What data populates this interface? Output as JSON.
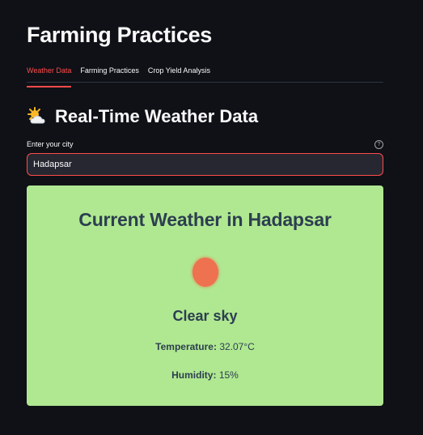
{
  "app": {
    "title": "Farming Practices"
  },
  "tabs": [
    {
      "label": "Weather Data",
      "active": true
    },
    {
      "label": "Farming Practices",
      "active": false
    },
    {
      "label": "Crop Yield Analysis",
      "active": false
    }
  ],
  "section": {
    "icon": "sun-behind-cloud-icon",
    "title": "Real-Time Weather Data"
  },
  "city_input": {
    "label": "Enter your city",
    "value": "Hadapsar",
    "help_icon": "question-circle-icon"
  },
  "weather": {
    "title": "Current Weather in Hadapsar",
    "icon": "sun-icon",
    "description": "Clear sky",
    "temperature_label": "Temperature:",
    "temperature_value": "32.07°C",
    "humidity_label": "Humidity:",
    "humidity_value": "15%"
  },
  "colors": {
    "accent": "#ff4b4b",
    "background": "#0f1117",
    "card": "#b0e891",
    "card_text": "#2c3e50",
    "sun": "#ee7150"
  }
}
